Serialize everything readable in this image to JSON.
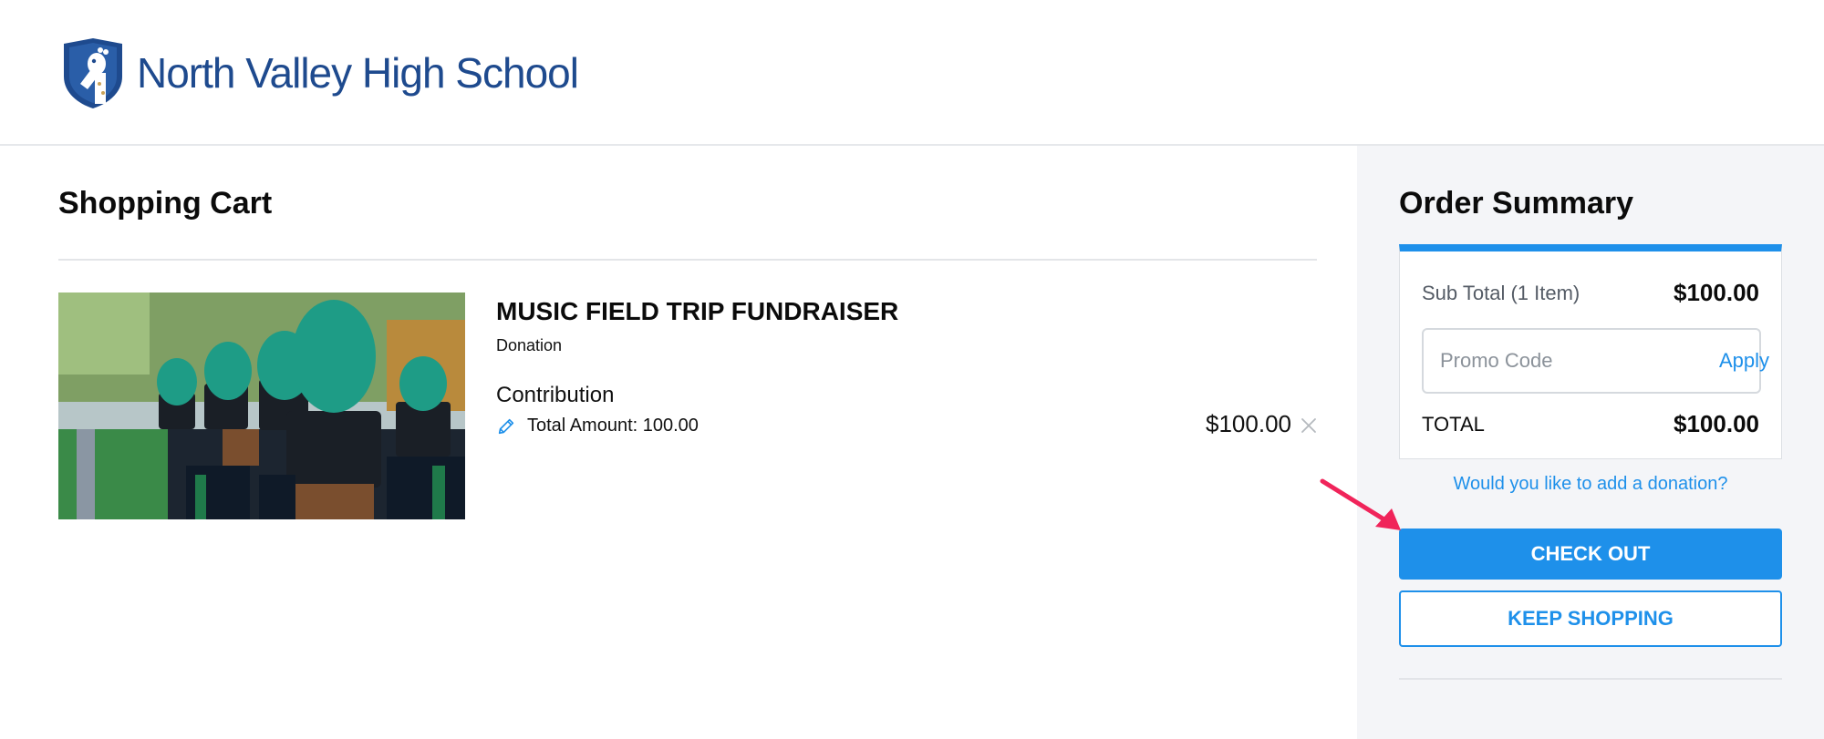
{
  "header": {
    "school_name": "North Valley High School",
    "logo_icon": "giraffe-shield-icon",
    "brand_color": "#1e4a8e"
  },
  "cart": {
    "title": "Shopping Cart",
    "item": {
      "title": "MUSIC FIELD TRIP FUNDRAISER",
      "type": "Donation",
      "option_label": "Contribution",
      "amount_text": "Total Amount: 100.00",
      "price": "$100.00",
      "edit_icon": "pencil-icon",
      "remove_icon": "close-icon",
      "image_description_icon": "marching-band-photo"
    }
  },
  "summary": {
    "title": "Order Summary",
    "subtotal_label": "Sub Total (1 Item)",
    "subtotal_value": "$100.00",
    "promo_placeholder": "Promo Code",
    "promo_value": "",
    "apply_label": "Apply",
    "total_label": "TOTAL",
    "total_value": "$100.00",
    "donation_link": "Would you like to add a donation?",
    "checkout_label": "CHECK OUT",
    "keep_shopping_label": "KEEP SHOPPING"
  },
  "colors": {
    "accent": "#1e90ea",
    "sidebar_bg": "#f4f5f8",
    "annotation_arrow": "#f0245a"
  }
}
